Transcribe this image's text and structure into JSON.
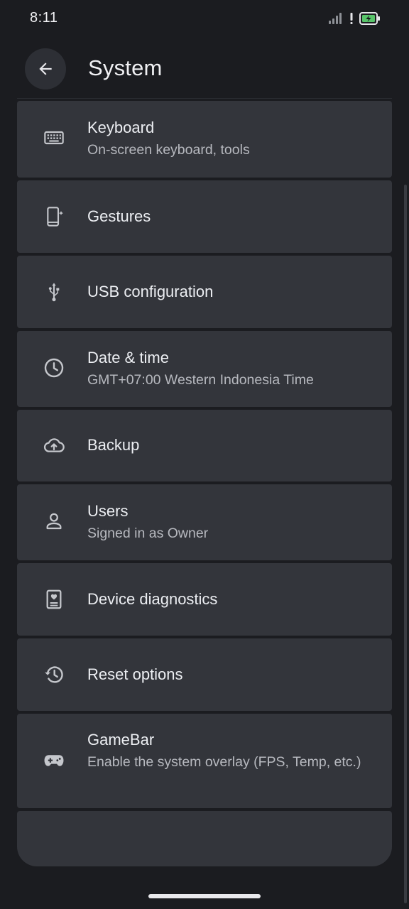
{
  "status_bar": {
    "time": "8:11",
    "icons": [
      "signal-icon",
      "alert-icon",
      "battery-charging-icon"
    ]
  },
  "header": {
    "title": "System",
    "back_icon": "arrow-back-icon"
  },
  "colors": {
    "background": "#1b1c20",
    "card": "#33353b",
    "text_primary": "#eceef2",
    "text_secondary": "#b7b9bf",
    "battery_accent": "#58c46a"
  },
  "items": [
    {
      "title": "Keyboard",
      "subtitle": "On-screen keyboard, tools",
      "icon": "keyboard-icon"
    },
    {
      "title": "Gestures",
      "subtitle": "",
      "icon": "gestures-icon"
    },
    {
      "title": "USB configuration",
      "subtitle": "",
      "icon": "usb-icon"
    },
    {
      "title": "Date & time",
      "subtitle": "GMT+07:00 Western Indonesia Time",
      "icon": "clock-icon"
    },
    {
      "title": "Backup",
      "subtitle": "",
      "icon": "cloud-upload-icon"
    },
    {
      "title": "Users",
      "subtitle": "Signed in as Owner",
      "icon": "person-icon"
    },
    {
      "title": "Device diagnostics",
      "subtitle": "",
      "icon": "diagnostics-icon"
    },
    {
      "title": "Reset options",
      "subtitle": "",
      "icon": "history-icon"
    },
    {
      "title": "GameBar",
      "subtitle": "Enable the system overlay (FPS, Temp, etc.)",
      "icon": "gamepad-icon"
    }
  ]
}
